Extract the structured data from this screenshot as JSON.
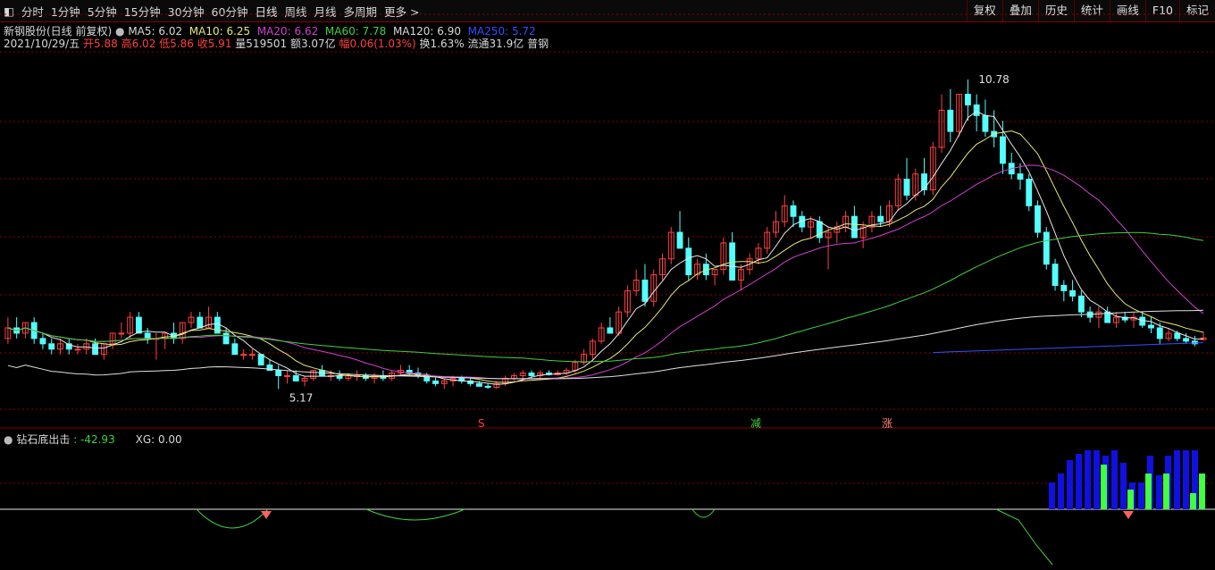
{
  "toolbar": {
    "tabs": [
      "分时",
      "1分钟",
      "5分钟",
      "15分钟",
      "30分钟",
      "60分钟",
      "日线",
      "周线",
      "月线",
      "多周期",
      "更多"
    ],
    "active_tab": "日线",
    "right_tools": [
      "复权",
      "叠加",
      "历史",
      "统计",
      "画线",
      "F10",
      "标记"
    ]
  },
  "header": {
    "stock_name": "新钢股份(日线 前复权)",
    "ma5": "MA5: 6.02",
    "ma10": "MA10: 6.25",
    "ma20": "MA20: 6.62",
    "ma60": "MA60: 7.78",
    "ma120": "MA120: 6.90",
    "ma250": "MA250: 5.72",
    "date": "2021/10/29/五",
    "open": "开5.88",
    "high": "高6.02",
    "low": "低5.86",
    "close": "收5.91",
    "volume": "量519501",
    "amount": "额3.07亿",
    "change": "幅0.06(1.03%)",
    "turnover": "换1.63%",
    "float": "流通31.9亿",
    "sector": "普钢"
  },
  "indicator": {
    "name": "钻石底出击",
    "value": ": -42.93",
    "xg": "XG: 0.00"
  },
  "colors": {
    "up": "#ff4040",
    "down": "#54ffff",
    "ma5": "#e8e8e8",
    "ma10": "#e8e870",
    "ma20": "#d040d0",
    "ma60": "#40d040",
    "ma120": "#e0e0e0",
    "ma250": "#3050ff",
    "grid": "#8a0000"
  },
  "chart_data": {
    "type": "candlestick",
    "y_range": [
      4.4,
      11.3
    ],
    "annotations": {
      "high": "10.78",
      "low": "5.17"
    },
    "markers": [
      "S",
      "减",
      "涨"
    ],
    "candles": [
      [
        5.9,
        6.3,
        5.8,
        6.1
      ],
      [
        6.1,
        6.3,
        5.9,
        6.0
      ],
      [
        6.0,
        6.2,
        5.9,
        6.2
      ],
      [
        6.2,
        6.3,
        5.8,
        5.9
      ],
      [
        5.9,
        6.0,
        5.7,
        5.8
      ],
      [
        5.8,
        5.9,
        5.6,
        5.7
      ],
      [
        5.7,
        5.9,
        5.6,
        5.8
      ],
      [
        5.8,
        5.9,
        5.6,
        5.7
      ],
      [
        5.7,
        5.8,
        5.6,
        5.7
      ],
      [
        5.7,
        5.9,
        5.6,
        5.8
      ],
      [
        5.8,
        5.9,
        5.6,
        5.6
      ],
      [
        5.6,
        5.8,
        5.5,
        5.8
      ],
      [
        5.8,
        6.0,
        5.7,
        6.0
      ],
      [
        6.0,
        6.2,
        5.9,
        6.0
      ],
      [
        6.0,
        6.4,
        5.9,
        6.3
      ],
      [
        6.3,
        6.4,
        6.0,
        6.0
      ],
      [
        6.0,
        6.1,
        5.8,
        5.9
      ],
      [
        5.9,
        6.0,
        5.5,
        5.9
      ],
      [
        5.9,
        6.0,
        5.7,
        6.0
      ],
      [
        6.0,
        6.2,
        5.8,
        5.9
      ],
      [
        5.9,
        6.2,
        5.8,
        6.2
      ],
      [
        6.2,
        6.4,
        6.1,
        6.3
      ],
      [
        6.3,
        6.4,
        6.1,
        6.1
      ],
      [
        6.1,
        6.5,
        6.1,
        6.3
      ],
      [
        6.3,
        6.4,
        6.0,
        6.0
      ],
      [
        6.0,
        6.1,
        5.8,
        5.8
      ],
      [
        5.8,
        5.9,
        5.6,
        5.6
      ],
      [
        5.6,
        5.7,
        5.5,
        5.6
      ],
      [
        5.6,
        5.7,
        5.5,
        5.6
      ],
      [
        5.6,
        5.6,
        5.4,
        5.4
      ],
      [
        5.4,
        5.5,
        5.3,
        5.3
      ],
      [
        5.3,
        5.4,
        4.95,
        5.2
      ],
      [
        5.2,
        5.3,
        5.05,
        5.2
      ],
      [
        5.2,
        5.3,
        5.1,
        5.1
      ],
      [
        5.1,
        5.2,
        5.0,
        5.15
      ],
      [
        5.15,
        5.3,
        5.1,
        5.3
      ],
      [
        5.3,
        5.4,
        5.2,
        5.2
      ],
      [
        5.2,
        5.3,
        5.1,
        5.2
      ],
      [
        5.2,
        5.3,
        5.1,
        5.15
      ],
      [
        5.15,
        5.25,
        5.1,
        5.2
      ],
      [
        5.2,
        5.3,
        5.1,
        5.2
      ],
      [
        5.2,
        5.25,
        5.1,
        5.15
      ],
      [
        5.15,
        5.25,
        5.05,
        5.2
      ],
      [
        5.2,
        5.3,
        5.1,
        5.15
      ],
      [
        5.15,
        5.3,
        5.1,
        5.25
      ],
      [
        5.25,
        5.4,
        5.2,
        5.3
      ],
      [
        5.3,
        5.4,
        5.2,
        5.25
      ],
      [
        5.25,
        5.35,
        5.15,
        5.2
      ],
      [
        5.2,
        5.25,
        5.05,
        5.1
      ],
      [
        5.1,
        5.2,
        5.0,
        5.05
      ],
      [
        5.05,
        5.15,
        4.95,
        5.1
      ],
      [
        5.1,
        5.2,
        5.0,
        5.15
      ],
      [
        5.15,
        5.2,
        5.05,
        5.1
      ],
      [
        5.1,
        5.15,
        5.0,
        5.05
      ],
      [
        5.05,
        5.1,
        5.0,
        5.0
      ],
      [
        5.0,
        5.05,
        4.95,
        4.98
      ],
      [
        4.98,
        5.1,
        4.95,
        5.05
      ],
      [
        5.05,
        5.2,
        5.0,
        5.15
      ],
      [
        5.15,
        5.25,
        5.1,
        5.2
      ],
      [
        5.2,
        5.3,
        5.1,
        5.25
      ],
      [
        5.25,
        5.3,
        5.15,
        5.2
      ],
      [
        5.2,
        5.3,
        5.15,
        5.25
      ],
      [
        5.25,
        5.3,
        5.2,
        5.22
      ],
      [
        5.22,
        5.3,
        5.2,
        5.25
      ],
      [
        5.25,
        5.35,
        5.2,
        5.3
      ],
      [
        5.3,
        5.5,
        5.25,
        5.45
      ],
      [
        5.45,
        5.7,
        5.4,
        5.6
      ],
      [
        5.6,
        5.9,
        5.5,
        5.85
      ],
      [
        5.85,
        6.2,
        5.8,
        6.1
      ],
      [
        6.1,
        6.3,
        6.0,
        6.0
      ],
      [
        6.0,
        6.5,
        5.95,
        6.4
      ],
      [
        6.4,
        6.9,
        6.3,
        6.8
      ],
      [
        6.8,
        7.2,
        6.7,
        7.0
      ],
      [
        7.0,
        7.3,
        6.5,
        6.6
      ],
      [
        6.6,
        7.2,
        6.5,
        7.1
      ],
      [
        7.1,
        7.5,
        7.0,
        7.4
      ],
      [
        7.4,
        8.0,
        7.3,
        7.9
      ],
      [
        7.9,
        8.3,
        7.8,
        7.6
      ],
      [
        7.6,
        7.8,
        7.0,
        7.1
      ],
      [
        7.1,
        7.4,
        7.0,
        7.3
      ],
      [
        7.3,
        7.5,
        7.0,
        7.1
      ],
      [
        7.1,
        7.2,
        6.9,
        7.2
      ],
      [
        7.2,
        7.8,
        7.1,
        7.7
      ],
      [
        7.7,
        7.9,
        7.0,
        7.0
      ],
      [
        7.0,
        7.3,
        6.8,
        7.2
      ],
      [
        7.2,
        7.5,
        7.1,
        7.4
      ],
      [
        7.4,
        7.7,
        7.3,
        7.6
      ],
      [
        7.6,
        8.0,
        7.5,
        7.9
      ],
      [
        7.9,
        8.3,
        7.8,
        8.1
      ],
      [
        8.1,
        8.6,
        8.0,
        8.4
      ],
      [
        8.4,
        8.5,
        8.0,
        8.2
      ],
      [
        8.2,
        8.3,
        7.9,
        8.0
      ],
      [
        8.0,
        8.2,
        7.8,
        8.1
      ],
      [
        8.1,
        8.2,
        7.7,
        7.8
      ],
      [
        7.8,
        8.0,
        7.2,
        7.9
      ],
      [
        7.9,
        8.1,
        7.7,
        8.0
      ],
      [
        8.0,
        8.3,
        7.9,
        8.2
      ],
      [
        8.2,
        8.4,
        7.8,
        7.8
      ],
      [
        7.8,
        8.1,
        7.6,
        8.0
      ],
      [
        8.0,
        8.3,
        7.9,
        8.2
      ],
      [
        8.2,
        8.4,
        8.0,
        8.1
      ],
      [
        8.1,
        8.5,
        8.0,
        8.4
      ],
      [
        8.4,
        9.0,
        8.3,
        8.9
      ],
      [
        8.9,
        9.3,
        8.5,
        8.6
      ],
      [
        8.6,
        9.1,
        8.5,
        9.0
      ],
      [
        9.0,
        9.3,
        8.6,
        8.7
      ],
      [
        8.7,
        9.6,
        8.6,
        9.5
      ],
      [
        9.5,
        10.5,
        9.4,
        10.2
      ],
      [
        10.2,
        10.6,
        9.6,
        9.8
      ],
      [
        9.8,
        10.5,
        9.7,
        10.5
      ],
      [
        10.5,
        10.78,
        10.0,
        10.3
      ],
      [
        10.3,
        10.5,
        9.8,
        10.1
      ],
      [
        10.1,
        10.4,
        9.7,
        9.8
      ],
      [
        9.8,
        10.2,
        9.5,
        9.7
      ],
      [
        9.7,
        10.0,
        9.0,
        9.2
      ],
      [
        9.2,
        9.4,
        8.9,
        9.0
      ],
      [
        9.0,
        9.2,
        8.7,
        8.9
      ],
      [
        8.9,
        9.0,
        8.3,
        8.4
      ],
      [
        8.4,
        8.5,
        7.8,
        7.9
      ],
      [
        7.9,
        8.0,
        7.2,
        7.3
      ],
      [
        7.3,
        7.4,
        6.8,
        6.9
      ],
      [
        6.9,
        7.0,
        6.6,
        6.8
      ],
      [
        6.8,
        7.0,
        6.6,
        6.7
      ],
      [
        6.7,
        6.8,
        6.3,
        6.4
      ],
      [
        6.4,
        6.5,
        6.2,
        6.3
      ],
      [
        6.3,
        6.5,
        6.1,
        6.4
      ],
      [
        6.4,
        6.5,
        6.2,
        6.2
      ],
      [
        6.2,
        6.4,
        6.1,
        6.3
      ],
      [
        6.3,
        6.4,
        6.2,
        6.25
      ],
      [
        6.25,
        6.4,
        6.1,
        6.3
      ],
      [
        6.3,
        6.4,
        6.1,
        6.15
      ],
      [
        6.15,
        6.3,
        6.0,
        6.1
      ],
      [
        6.1,
        6.2,
        5.8,
        5.9
      ],
      [
        5.9,
        6.1,
        5.85,
        6.0
      ],
      [
        6.0,
        6.05,
        5.85,
        5.9
      ],
      [
        5.9,
        6.0,
        5.8,
        5.85
      ],
      [
        5.85,
        5.95,
        5.75,
        5.8
      ],
      [
        5.88,
        6.02,
        5.86,
        5.91
      ]
    ],
    "indicator_series": {
      "diamond_line_min": -60,
      "bars_blue": [
        30,
        40,
        55,
        62,
        66,
        66,
        60,
        66,
        52,
        30,
        30,
        60,
        38,
        60,
        66,
        66,
        66
      ],
      "bars_green": [
        50,
        22,
        40,
        40,
        18,
        40
      ]
    }
  }
}
